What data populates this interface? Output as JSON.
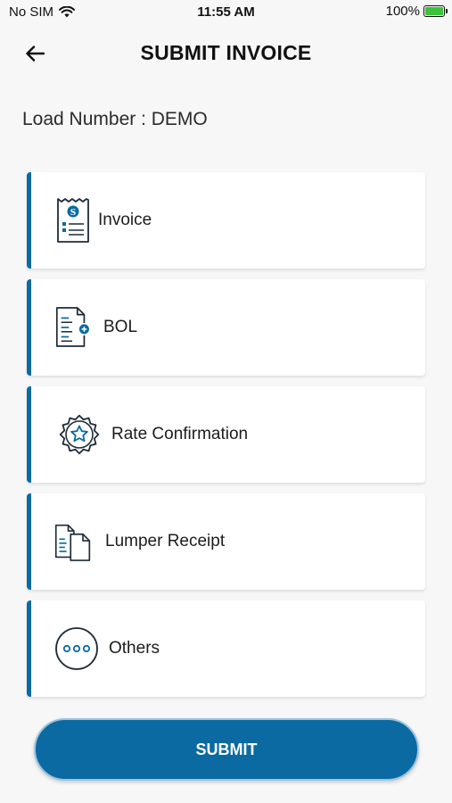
{
  "status_bar": {
    "carrier": "No SIM",
    "time": "11:55 AM",
    "battery": "100%"
  },
  "header": {
    "title": "SUBMIT INVOICE"
  },
  "load": {
    "text": "Load Number : DEMO"
  },
  "documents": [
    {
      "label": "Invoice",
      "icon": "invoice-icon"
    },
    {
      "label": "BOL",
      "icon": "bol-document-icon"
    },
    {
      "label": "Rate Confirmation",
      "icon": "star-badge-icon"
    },
    {
      "label": "Lumper Receipt",
      "icon": "receipt-copy-icon"
    },
    {
      "label": "Others",
      "icon": "more-dots-icon"
    }
  ],
  "submit": {
    "label": "SUBMIT"
  },
  "colors": {
    "accent": "#0a6aa1",
    "background": "#f7f7f7",
    "card": "#ffffff",
    "battery": "#3ac43a"
  }
}
